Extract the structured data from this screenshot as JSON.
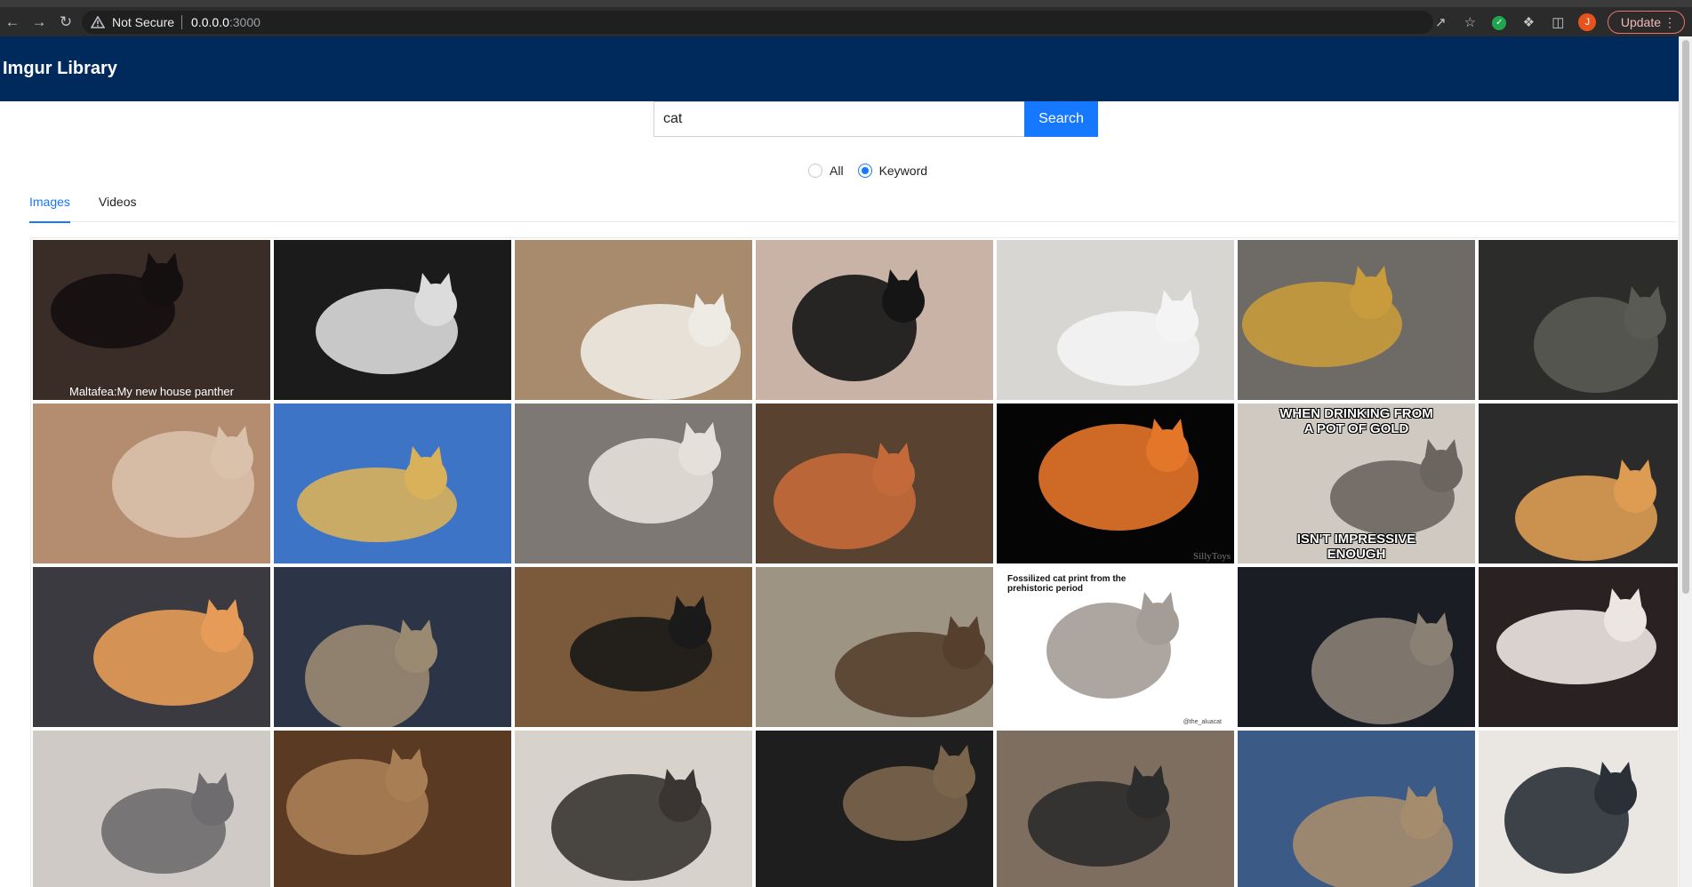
{
  "browser": {
    "not_secure": "Not Secure",
    "url_host": "0.0.0.0",
    "url_rest": ":3000",
    "update_label": "Update",
    "profile_initial": "J"
  },
  "app": {
    "title": "Imgur Library"
  },
  "search": {
    "value": "cat",
    "button_label": "Search"
  },
  "filters": {
    "options": [
      "All",
      "Keyword"
    ],
    "selected": "Keyword"
  },
  "tabs": [
    {
      "label": "Images",
      "active": true
    },
    {
      "label": "Videos",
      "active": false
    }
  ],
  "gallery": {
    "items": [
      {
        "caption": "Maltafea:My new house panther",
        "scene": "black kitten on leather couch",
        "bg": "#3a2c26",
        "fg": "#141010"
      },
      {
        "caption": "",
        "scene": "black and white cat on star blanket",
        "bg": "#1b1b1b",
        "fg": "#dcdcdc"
      },
      {
        "caption": "",
        "scene": "white fluffy cat held up",
        "bg": "#a88b6c",
        "fg": "#eeeae4"
      },
      {
        "caption": "",
        "scene": "black cat close up",
        "bg": "#c9b3a6",
        "fg": "#151515"
      },
      {
        "caption": "",
        "scene": "white cat with ribbons",
        "bg": "#d8d6d2",
        "fg": "#f4f4f4"
      },
      {
        "caption": "",
        "scene": "cat in a pet store",
        "bg": "#6e6a66",
        "fg": "#c89b3c"
      },
      {
        "caption": "",
        "scene": "dark abandoned hallway",
        "bg": "#2c2c2a",
        "fg": "#5a5a54"
      },
      {
        "caption": "",
        "scene": "cat in a paper bag",
        "bg": "#b48d70",
        "fg": "#d9c1ab"
      },
      {
        "caption": "",
        "scene": "cartoon cat hugging a shark",
        "bg": "#3d74c6",
        "fg": "#d8b15a"
      },
      {
        "caption": "",
        "scene": "white and brown cat on bed",
        "bg": "#7e7874",
        "fg": "#e6e0da"
      },
      {
        "caption": "",
        "scene": "cat in a clay pot",
        "bg": "#5a4230",
        "fg": "#c46a3a"
      },
      {
        "caption": "",
        "scene": "cartoon cat figurine",
        "bg": "#050505",
        "fg": "#e4762a"
      },
      {
        "caption": "",
        "scene": "tabby cat with rainbow meme",
        "bg": "#cfc9c2",
        "fg": "#6b655f"
      },
      {
        "caption": "",
        "scene": "orange cat on blanket",
        "bg": "#2b2b2b",
        "fg": "#dd9c52"
      },
      {
        "caption": "",
        "scene": "two cats on lap",
        "bg": "#3a3a40",
        "fg": "#e69c58"
      },
      {
        "caption": "",
        "scene": "tabby cat in basket",
        "bg": "#2c3548",
        "fg": "#9a8a72"
      },
      {
        "caption": "",
        "scene": "black cat collage",
        "bg": "#7a5a3a",
        "fg": "#1a1a1a"
      },
      {
        "caption": "",
        "scene": "cat under a table",
        "bg": "#9d9483",
        "fg": "#56402d"
      },
      {
        "caption": "",
        "scene": "fossilized cat print meme",
        "bg": "#ffffff",
        "fg": "#a49c96"
      },
      {
        "caption": "",
        "scene": "tabby and black cat",
        "bg": "#1a1d24",
        "fg": "#8a8074"
      },
      {
        "caption": "",
        "scene": "white cat on bed",
        "bg": "#2a2222",
        "fg": "#ece6e2"
      },
      {
        "caption": "",
        "scene": "gray cat lying on carpet",
        "bg": "#cfcac6",
        "fg": "#6e6c6e"
      },
      {
        "caption": "",
        "scene": "sleeping tabby cat",
        "bg": "#5b3a24",
        "fg": "#a87f55"
      },
      {
        "caption": "",
        "scene": "cats sleeping pile",
        "bg": "#d8d2cc",
        "fg": "#3a3532"
      },
      {
        "caption": "",
        "scene": "fluffy cat on sink",
        "bg": "#1e1e1e",
        "fg": "#7a644c"
      },
      {
        "caption": "",
        "scene": "cat on carpet from above",
        "bg": "#7e6e60",
        "fg": "#2c2c2c"
      },
      {
        "caption": "",
        "scene": "tabby cat curled in box",
        "bg": "#3c5a86",
        "fg": "#a58c6d"
      },
      {
        "caption": "",
        "scene": "cat tree",
        "bg": "#eae6e2",
        "fg": "#2a3038"
      }
    ],
    "overlay_texts": {
      "tile_12_top": "WHEN DRINKING FROM\nA POT OF GOLD",
      "tile_12_bottom": "ISN'T IMPRESSIVE\nENOUGH",
      "tile_11_corner": "SillyToys",
      "tile_18_top": "Fossilized cat print from the\nprehistoric period",
      "tile_18_corner": "@the_aluacat"
    }
  }
}
